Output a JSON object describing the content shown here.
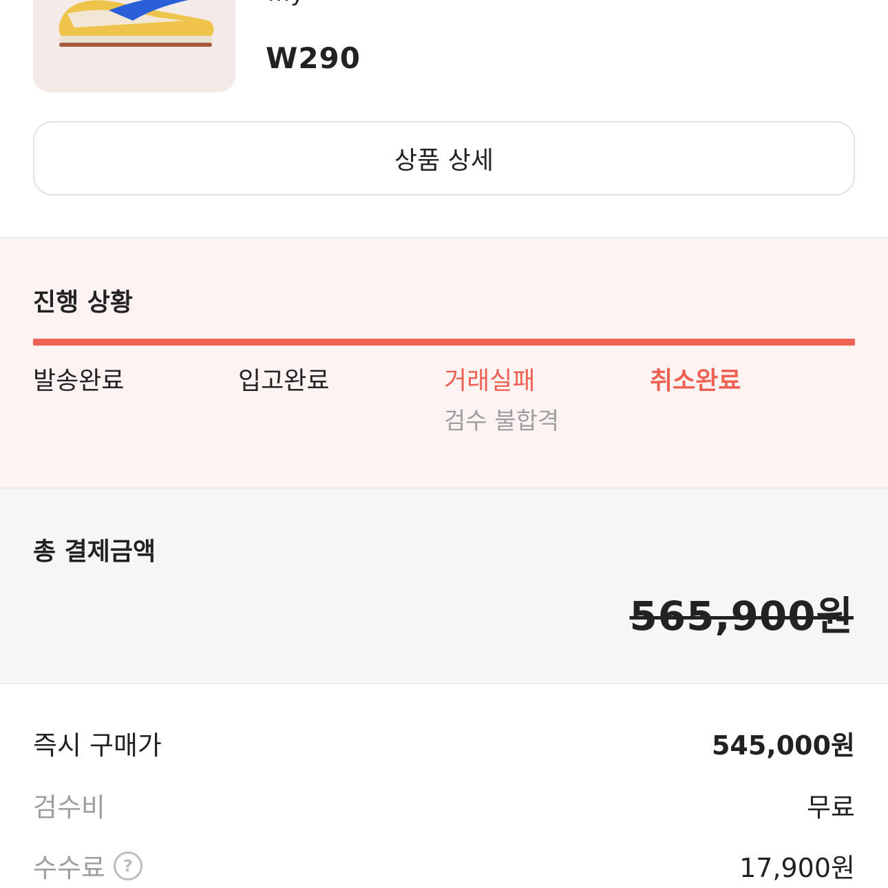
{
  "product": {
    "name_partial": "…y",
    "size": "W290"
  },
  "detail_button_label": "상품 상세",
  "progress": {
    "title": "진행 상황",
    "fill_fraction": 1.0,
    "steps": [
      {
        "label": "발송완료",
        "sub": ""
      },
      {
        "label": "입고완료",
        "sub": ""
      },
      {
        "label": "거래실패",
        "sub": "검수 불합격"
      },
      {
        "label": "취소완료",
        "sub": ""
      }
    ],
    "accent_color": "#ef6253"
  },
  "total": {
    "title": "총 결제금액",
    "amount": "565,900원"
  },
  "breakdown": {
    "instant_price_label": "즉시 구매가",
    "instant_price_value": "545,000원",
    "inspection_fee_label": "검수비",
    "inspection_fee_value": "무료",
    "commission_label": "수수료",
    "commission_value": "17,900원",
    "help_icon_glyph": "?"
  },
  "icons": [
    "sneaker-image",
    "help-icon"
  ]
}
